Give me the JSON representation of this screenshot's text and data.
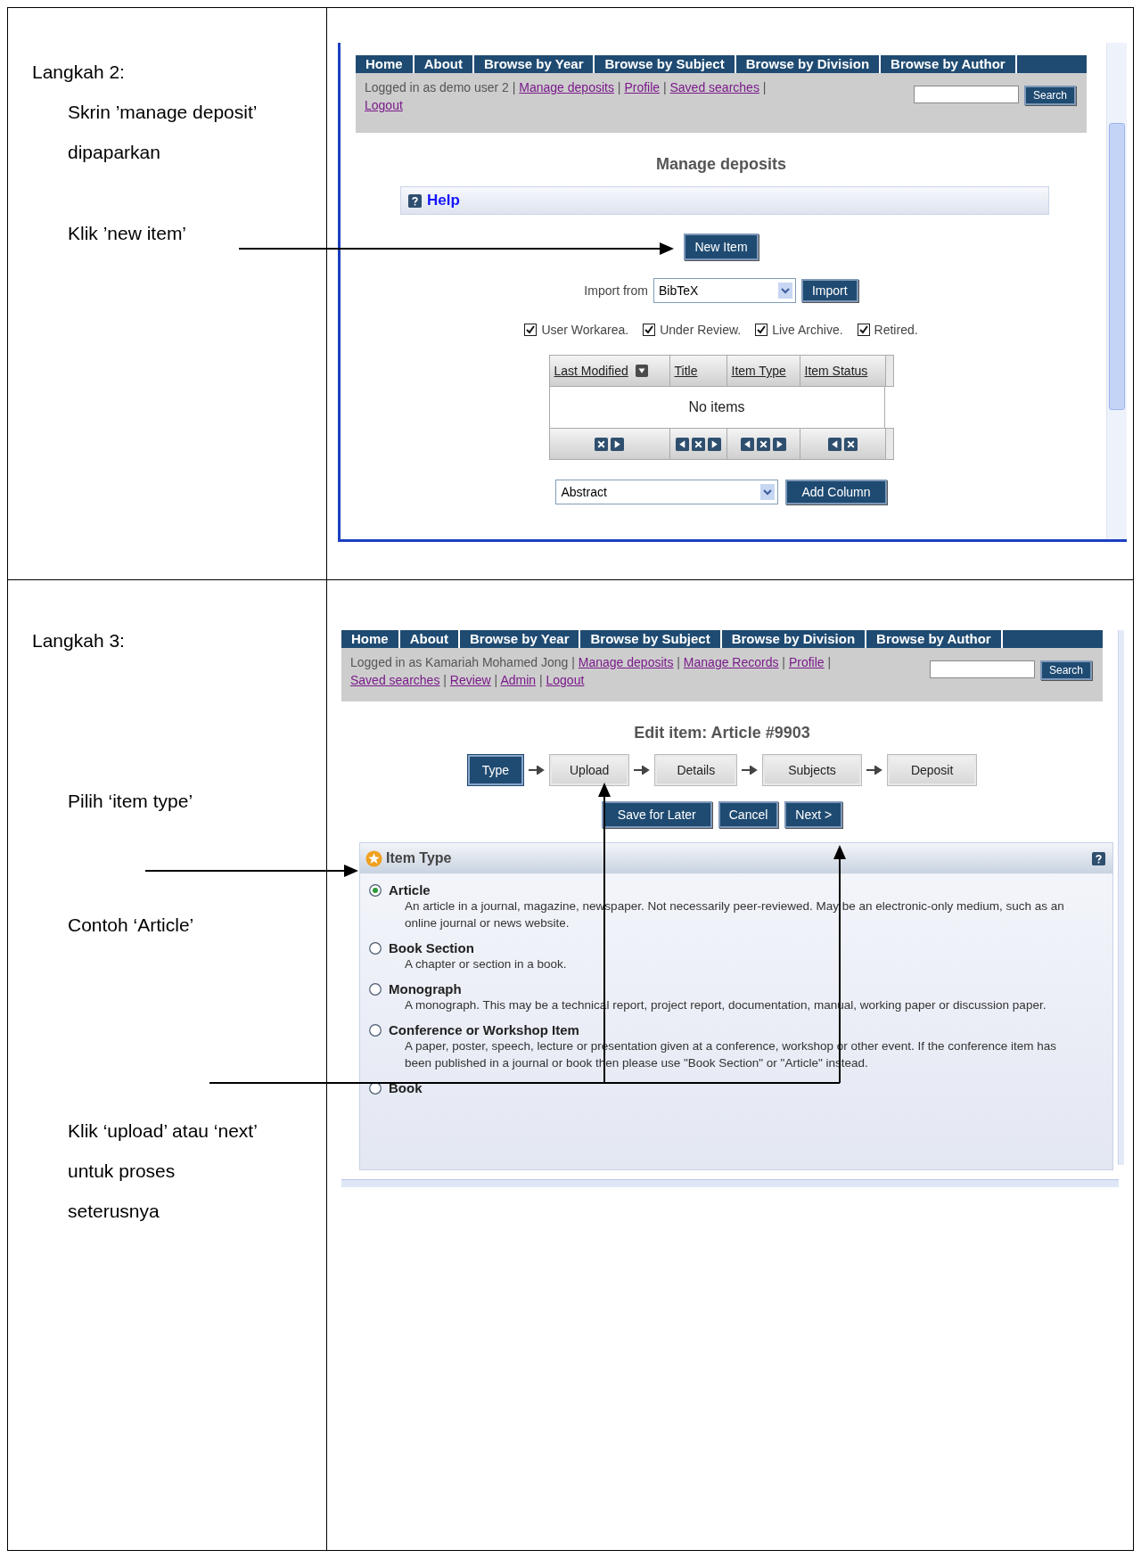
{
  "step_2": {
    "heading": "Langkah 2:",
    "notes": [
      "Skrin ’manage deposit’\ndipaparkan",
      "Klik ’new item’"
    ],
    "screen": {
      "nav": [
        "Home",
        "About",
        "Browse by Year",
        "Browse by Subject",
        "Browse by Division",
        "Browse by Author"
      ],
      "login": [
        {
          "text": "Logged in as demo user 2 | ",
          "kind": "text"
        },
        {
          "text": "Manage deposits",
          "kind": "link"
        },
        {
          "text": " | ",
          "kind": "text"
        },
        {
          "text": "Profile",
          "kind": "link"
        },
        {
          "text": " | ",
          "kind": "text"
        },
        {
          "text": "Saved searches",
          "kind": "link"
        },
        {
          "text": " | ",
          "kind": "text"
        },
        {
          "text": "Logout",
          "kind": "link"
        }
      ],
      "search_button": "Search",
      "title": "Manage deposits",
      "help": "Help",
      "new_item": "New Item",
      "import": {
        "label": "Import from",
        "value": "BibTeX",
        "button": "Import"
      },
      "filters": [
        {
          "label": "User Workarea.",
          "checked": true
        },
        {
          "label": "Under Review.",
          "checked": true
        },
        {
          "label": "Live Archive.",
          "checked": true
        },
        {
          "label": "Retired.",
          "checked": true
        }
      ],
      "table": {
        "columns": [
          {
            "label": "Last Modified",
            "sorted": true
          },
          {
            "label": "Title",
            "sorted": false
          },
          {
            "label": "Item Type",
            "sorted": false
          },
          {
            "label": "Item Status",
            "sorted": false
          }
        ],
        "empty": "No items"
      },
      "add_column": {
        "value": "Abstract",
        "button": "Add Column"
      }
    }
  },
  "step_3": {
    "heading": "Langkah 3:",
    "notes": [
      "Pilih ‘item type’",
      "Contoh ‘Article’",
      "Klik ‘upload’ atau ‘next’\nuntuk proses\nseterusnya"
    ],
    "screen": {
      "nav": [
        "Home",
        "About",
        "Browse by Year",
        "Browse by Subject",
        "Browse by Division",
        "Browse by Author"
      ],
      "login": [
        {
          "text": "Logged in as Kamariah Mohamed Jong | ",
          "kind": "text"
        },
        {
          "text": "Manage deposits",
          "kind": "link"
        },
        {
          "text": " | ",
          "kind": "text"
        },
        {
          "text": "Manage Records",
          "kind": "link"
        },
        {
          "text": " | ",
          "kind": "text"
        },
        {
          "text": "Profile",
          "kind": "link"
        },
        {
          "text": " | ",
          "kind": "text"
        },
        {
          "text": "Saved searches",
          "kind": "link"
        },
        {
          "text": " | ",
          "kind": "text"
        },
        {
          "text": "Review",
          "kind": "link"
        },
        {
          "text": " | ",
          "kind": "text"
        },
        {
          "text": "Admin",
          "kind": "link"
        },
        {
          "text": " | ",
          "kind": "text"
        },
        {
          "text": "Logout",
          "kind": "link"
        }
      ],
      "search_button": "Search",
      "title": "Edit item: Article #9903",
      "stages": [
        {
          "label": "Type",
          "selected": true
        },
        {
          "label": "Upload",
          "selected": false
        },
        {
          "label": "Details",
          "selected": false
        },
        {
          "label": "Subjects",
          "selected": false
        },
        {
          "label": "Deposit",
          "selected": false
        }
      ],
      "buttons": [
        "Save for Later",
        "Cancel",
        "Next >"
      ],
      "panel_title": "Item Type",
      "item_types": [
        {
          "label": "Article",
          "description": "An article in a journal, magazine, newspaper. Not necessarily peer-reviewed. May be an electronic-only medium, such as an online journal or news website.",
          "selected": true
        },
        {
          "label": "Book Section",
          "description": "A chapter or section in a book.",
          "selected": false
        },
        {
          "label": "Monograph",
          "description": "A monograph. This may be a technical report, project report, documentation, manual, working paper or discussion paper.",
          "selected": false
        },
        {
          "label": "Conference or Workshop Item",
          "description": "A paper, poster, speech, lecture or presentation given at a conference, workshop or other event. If the conference item has been published in a journal or book then please use \"Book Section\" or \"Article\" instead.",
          "selected": false
        },
        {
          "label": "Book",
          "selected": false
        }
      ]
    }
  }
}
